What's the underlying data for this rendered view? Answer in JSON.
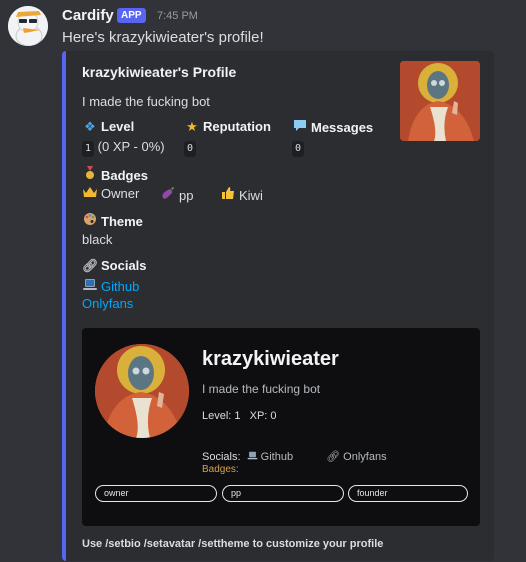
{
  "message": {
    "bot_name": "Cardify",
    "app_tag": "APP",
    "timestamp": "7:45 PM",
    "text": "Here's krazykiwieater's profile!"
  },
  "embed": {
    "title": "krazykiwieater's Profile",
    "description": "I made the fucking bot",
    "fields": {
      "level": {
        "name": "Level",
        "value": "1",
        "suffix": "(0 XP - 0%)"
      },
      "reputation": {
        "name": "Reputation",
        "value": "0"
      },
      "messages": {
        "name": "Messages",
        "value": "0"
      },
      "badges": {
        "name": "Badges",
        "items": [
          {
            "label": "Owner",
            "icon": "crown-icon"
          },
          {
            "label": "pp",
            "icon": "eggplant-icon"
          },
          {
            "label": "Kiwi",
            "icon": "thumbs-up-icon"
          }
        ]
      },
      "theme": {
        "name": "Theme",
        "value": "black"
      },
      "socials": {
        "name": "Socials",
        "links": [
          {
            "label": "Github",
            "icon": "laptop-icon"
          },
          {
            "label": "Onlyfans"
          }
        ]
      }
    },
    "card": {
      "username": "krazykiwieater",
      "bio": "I made the fucking bot",
      "level_label": "Level:",
      "level_value": "1",
      "xp_label": "XP:",
      "xp_value": "0",
      "socials_label": "Socials:",
      "github": "Github",
      "onlyfans": "Onlyfans",
      "badges_label": "Badges:",
      "pills": [
        "owner",
        "pp",
        "founder"
      ]
    },
    "footer": "Use /setbio /setavatar /settheme to customize your profile"
  },
  "colors": {
    "background": "#313338",
    "embed_background": "#2b2d31",
    "embed_accent": "#5865f2",
    "link": "#00a8fc",
    "card_background": "#0e0e10",
    "badge_label": "#d4a04c"
  }
}
